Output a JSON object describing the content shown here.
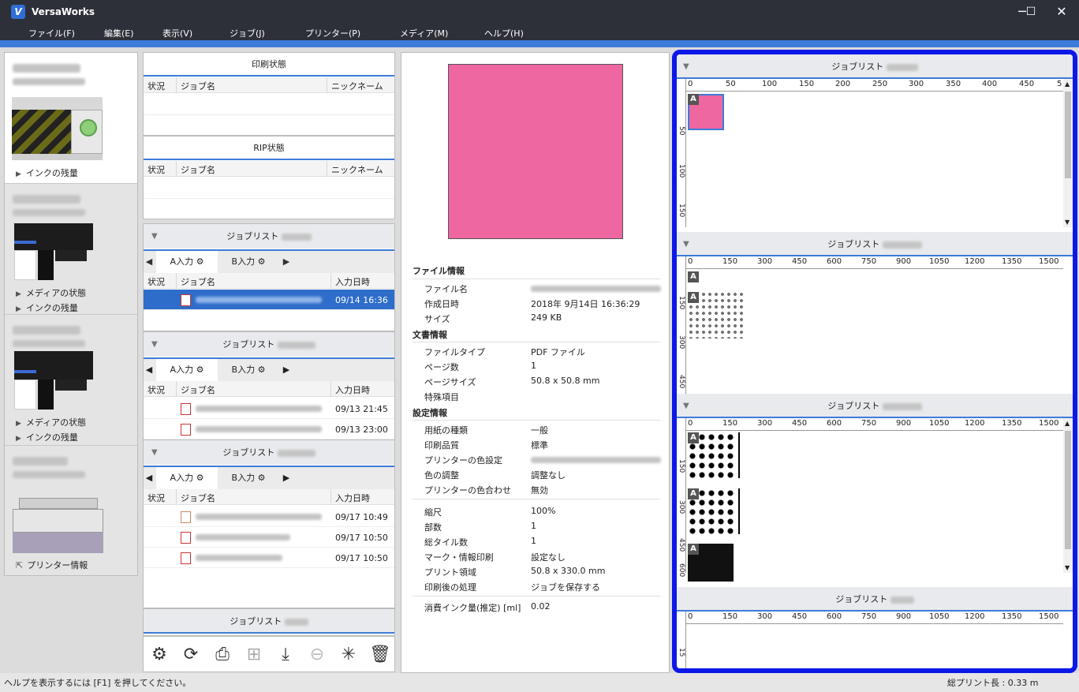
{
  "app": {
    "title": "VersaWorks",
    "logo_glyph": "V"
  },
  "window_controls": {
    "minimize": "─",
    "maximize": "☐",
    "close": "✕"
  },
  "menu": [
    "ファイル(F)",
    "編集(E)",
    "表示(V)",
    "ジョブ(J)",
    "プリンター(P)",
    "メディア(M)",
    "ヘルプ(H)"
  ],
  "printers": {
    "p1_link": "インクの残量",
    "p2_links": [
      "メディアの状態",
      "インクの残量"
    ],
    "p3_links": [
      "メディアの状態",
      "インクの残量"
    ],
    "p4_link": "プリンター情報"
  },
  "print_status": {
    "title": "印刷状態",
    "cols": [
      "状況",
      "ジョブ名",
      "ニックネーム"
    ]
  },
  "rip_status": {
    "title": "RIP状態",
    "cols": [
      "状況",
      "ジョブ名",
      "ニックネーム"
    ]
  },
  "joblists": [
    {
      "title": "ジョブリスト",
      "tabs": [
        "A入力",
        "B入力"
      ],
      "cols": [
        "状況",
        "ジョブ名",
        "入力日時"
      ],
      "rows": [
        {
          "date": "09/14 16:36",
          "selected": true
        }
      ]
    },
    {
      "title": "ジョブリスト",
      "tabs": [
        "A入力",
        "B入力"
      ],
      "cols": [
        "状況",
        "ジョブ名",
        "入力日時"
      ],
      "rows": [
        {
          "date": "09/13 21:45"
        },
        {
          "date": "09/13 23:00"
        }
      ]
    },
    {
      "title": "ジョブリスト",
      "tabs": [
        "A入力",
        "B入力"
      ],
      "cols": [
        "状況",
        "ジョブ名",
        "入力日時"
      ],
      "rows": [
        {
          "date": "09/17 10:49"
        },
        {
          "date": "09/17 10:50"
        },
        {
          "date": "09/17 10:50"
        }
      ]
    },
    {
      "title": "ジョブリスト"
    }
  ],
  "details": {
    "preview_color": "#ee67a1",
    "file_info": {
      "title": "ファイル情報",
      "name_label": "ファイル名",
      "created_label": "作成日時",
      "created": "2018年 9月14日 16:36:29",
      "size_label": "サイズ",
      "size": "249 KB"
    },
    "doc_info": {
      "title": "文書情報",
      "type_label": "ファイルタイプ",
      "type": "PDF ファイル",
      "pages_label": "ページ数",
      "pages": "1",
      "pagesize_label": "ページサイズ",
      "pagesize": "50.8 x 50.8 mm",
      "special_label": "特殊項目"
    },
    "settings": {
      "title": "設定情報",
      "media_label": "用紙の種類",
      "media": "一般",
      "quality_label": "印刷品質",
      "quality": "標準",
      "color_setting_label": "プリンターの色設定",
      "color_adjust_label": "色の調整",
      "color_adjust": "調整なし",
      "color_match_label": "プリンターの色合わせ",
      "color_match": "無効",
      "scale_label": "縮尺",
      "scale": "100%",
      "copies_label": "部数",
      "copies": "1",
      "tiles_label": "総タイル数",
      "tiles": "1",
      "marks_label": "マーク・情報印刷",
      "marks": "設定なし",
      "area_label": "プリント領域",
      "area": "50.8 x 330.0 mm",
      "after_label": "印刷後の処理",
      "after": "ジョブを保存する",
      "ink_label": "消費インク量(推定) [ml]",
      "ink": "0.02"
    }
  },
  "layout": {
    "panels": [
      {
        "title": "ジョブリスト",
        "ruler": [
          "0",
          "50",
          "100",
          "150",
          "200",
          "250",
          "300",
          "350",
          "400",
          "450",
          "5"
        ],
        "vruler": [
          "50",
          "100",
          "150"
        ]
      },
      {
        "title": "ジョブリスト",
        "ruler": [
          "0",
          "150",
          "300",
          "450",
          "600",
          "750",
          "900",
          "1050",
          "1200",
          "1350",
          "1500"
        ],
        "vruler": [
          "150",
          "300",
          "450"
        ]
      },
      {
        "title": "ジョブリスト",
        "ruler": [
          "0",
          "150",
          "300",
          "450",
          "600",
          "750",
          "900",
          "1050",
          "1200",
          "1350",
          "1500"
        ],
        "vruler": [
          "150",
          "300",
          "450",
          "600"
        ]
      },
      {
        "title": "ジョブリスト",
        "ruler": [
          "0",
          "150",
          "300",
          "450",
          "600",
          "750",
          "900",
          "1050",
          "1200",
          "1350",
          "1500"
        ],
        "vruler": [
          "15"
        ]
      }
    ],
    "badge": "A",
    "border_color": "#0b18e8"
  },
  "status": {
    "help": "ヘルプを表示するには [F1] を押してください。",
    "total": "総プリント長 : 0.33 m"
  },
  "colors": {
    "titlebar": "#2d3039",
    "accent": "#3d7bd9",
    "selection": "#2e6dc9"
  }
}
